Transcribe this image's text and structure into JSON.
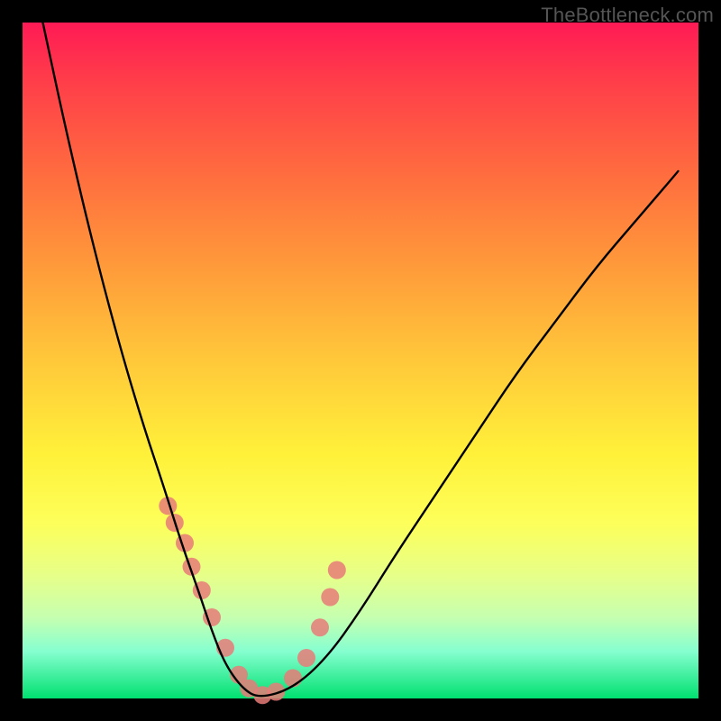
{
  "watermark": "TheBottleneck.com",
  "chart_data": {
    "type": "line",
    "title": "",
    "xlabel": "",
    "ylabel": "",
    "xlim": [
      0,
      1
    ],
    "ylim": [
      0,
      1
    ],
    "series": [
      {
        "name": "bottleneck-curve",
        "x": [
          0.03,
          0.06,
          0.09,
          0.12,
          0.15,
          0.18,
          0.21,
          0.235,
          0.26,
          0.28,
          0.3,
          0.325,
          0.35,
          0.4,
          0.45,
          0.5,
          0.55,
          0.61,
          0.67,
          0.73,
          0.79,
          0.85,
          0.91,
          0.97
        ],
        "y": [
          1.0,
          0.86,
          0.73,
          0.61,
          0.5,
          0.4,
          0.31,
          0.23,
          0.16,
          0.1,
          0.05,
          0.015,
          0.0,
          0.015,
          0.06,
          0.13,
          0.21,
          0.3,
          0.39,
          0.48,
          0.56,
          0.64,
          0.71,
          0.78
        ]
      },
      {
        "name": "highlight-markers",
        "x": [
          0.215,
          0.225,
          0.24,
          0.25,
          0.265,
          0.28,
          0.3,
          0.32,
          0.335,
          0.355,
          0.375,
          0.4,
          0.42,
          0.44,
          0.455,
          0.465
        ],
        "y": [
          0.285,
          0.26,
          0.23,
          0.195,
          0.16,
          0.12,
          0.075,
          0.035,
          0.015,
          0.005,
          0.01,
          0.03,
          0.06,
          0.105,
          0.15,
          0.19
        ]
      }
    ]
  }
}
